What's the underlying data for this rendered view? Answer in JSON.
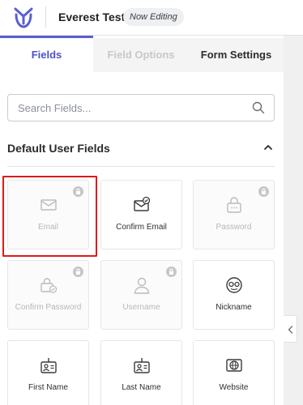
{
  "header": {
    "form_title": "Everest Test",
    "status_badge": "Now Editing",
    "brand_color": "#5a5ed4"
  },
  "tabs": [
    {
      "label": "Fields",
      "state": "active"
    },
    {
      "label": "Field Options",
      "state": "disabled"
    },
    {
      "label": "Form Settings",
      "state": "inactive"
    }
  ],
  "search": {
    "placeholder": "Search Fields...",
    "value": ""
  },
  "section": {
    "title": "Default User Fields",
    "expanded": true
  },
  "fields": [
    {
      "label": "Email",
      "icon": "envelope-icon",
      "locked": true,
      "highlighted": true
    },
    {
      "label": "Confirm Email",
      "icon": "envelope-check-icon",
      "locked": false
    },
    {
      "label": "Password",
      "icon": "password-lock-icon",
      "locked": true
    },
    {
      "label": "Confirm Password",
      "icon": "password-check-icon",
      "locked": true
    },
    {
      "label": "Username",
      "icon": "user-icon",
      "locked": true
    },
    {
      "label": "Nickname",
      "icon": "nickname-mask-icon",
      "locked": false
    },
    {
      "label": "First Name",
      "icon": "id-card-icon",
      "locked": false
    },
    {
      "label": "Last Name",
      "icon": "id-card-icon",
      "locked": false
    },
    {
      "label": "Website",
      "icon": "globe-icon",
      "locked": false
    }
  ],
  "colors": {
    "accent": "#4b51c9",
    "highlight": "#e01919",
    "locked_text": "#b5b7bd"
  }
}
